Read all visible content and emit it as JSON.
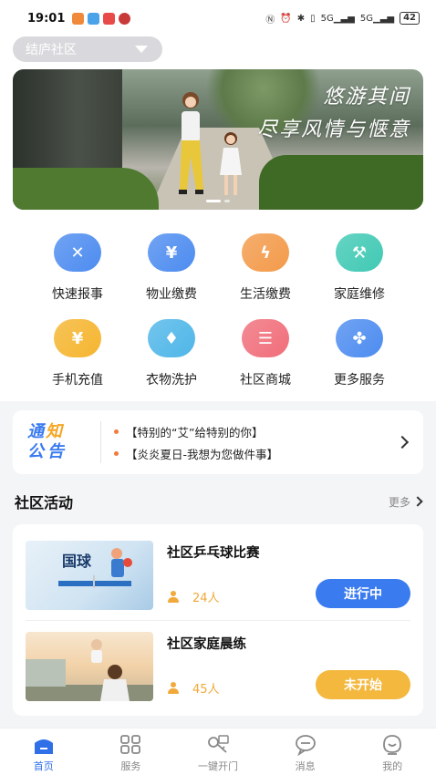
{
  "status_bar": {
    "time": "19:01",
    "network_left": "5G",
    "network_right": "5G",
    "battery": "42"
  },
  "header": {
    "community_name": "结庐社区"
  },
  "banner": {
    "line1": "悠游其间",
    "line2": "尽享风情与惬意"
  },
  "services": [
    {
      "label": "快速报事",
      "icon": "wrench-icon",
      "color": "#4d8cf0",
      "glyph": "✕"
    },
    {
      "label": "物业缴费",
      "icon": "house-yen-icon",
      "color": "#4d8cf0",
      "glyph": "¥"
    },
    {
      "label": "生活缴费",
      "icon": "lightning-icon",
      "color": "#f39a4a",
      "glyph": "ϟ"
    },
    {
      "label": "家庭维修",
      "icon": "hammer-icon",
      "color": "#40c9b4",
      "glyph": "⚒"
    },
    {
      "label": "手机充值",
      "icon": "phone-yen-icon",
      "color": "#f5b52f",
      "glyph": "¥"
    },
    {
      "label": "衣物洗护",
      "icon": "shirt-icon",
      "color": "#4fb6e8",
      "glyph": "♦"
    },
    {
      "label": "社区商城",
      "icon": "shop-icon",
      "color": "#f06e7a",
      "glyph": "☰"
    },
    {
      "label": "更多服务",
      "icon": "grid-icon",
      "color": "#4d8cf0",
      "glyph": "✤"
    }
  ],
  "notice": {
    "title_line1a": "通",
    "title_line1b": "知",
    "title_line2": "公告",
    "items": [
      "【特别的“艾”给特别的你】",
      "【炎炎夏日-我想为您做件事】"
    ]
  },
  "activities_section": {
    "title": "社区活动",
    "more": "更多"
  },
  "activities": [
    {
      "title": "社区乒乓球比赛",
      "count": "24人",
      "status": "进行中",
      "status_color": "#3a7bf0",
      "thumb_text": "国球"
    },
    {
      "title": "社区家庭晨练",
      "count": "45人",
      "status": "未开始",
      "status_color": "#f3b83d",
      "thumb_text": ""
    }
  ],
  "tabbar": [
    {
      "label": "首页",
      "icon": "home-icon",
      "active": true
    },
    {
      "label": "服务",
      "icon": "apps-grid-icon",
      "active": false
    },
    {
      "label": "一键开门",
      "icon": "key-icon",
      "active": false
    },
    {
      "label": "消息",
      "icon": "chat-bubble-icon",
      "active": false
    },
    {
      "label": "我的",
      "icon": "profile-icon",
      "active": false
    }
  ]
}
